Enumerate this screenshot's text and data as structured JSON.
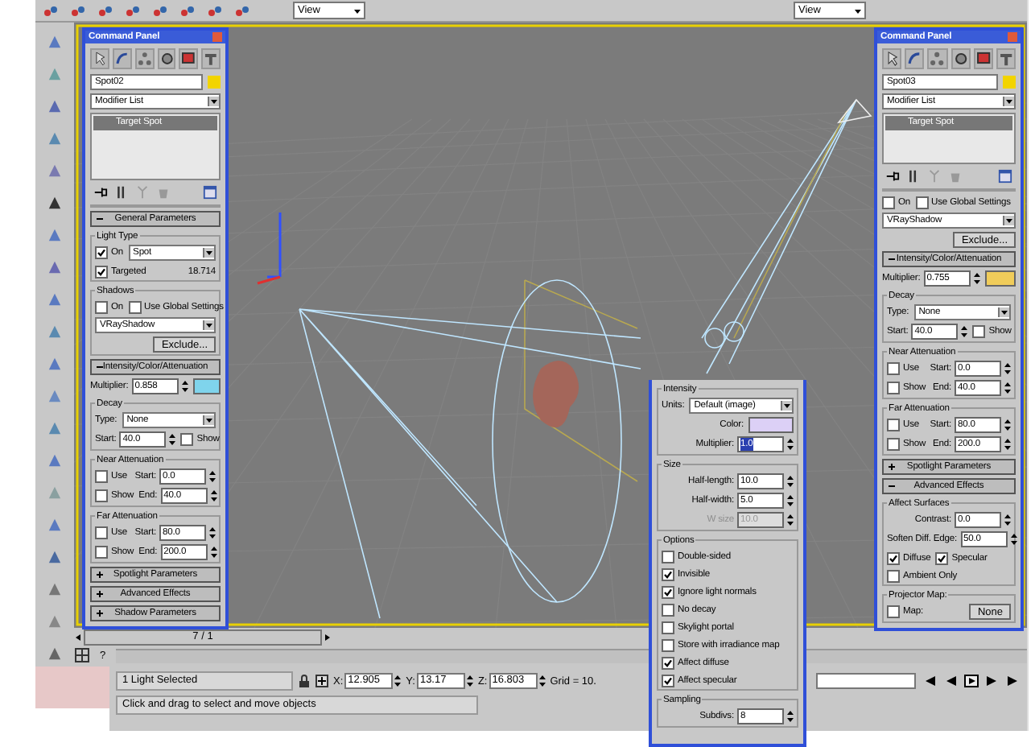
{
  "top_toolbar": {
    "dropdowns": [
      {
        "value": "View"
      },
      {
        "value": "View"
      }
    ]
  },
  "left_panel": {
    "title": "Command Panel",
    "object_name": "Spot02",
    "modifier_list": "Modifier List",
    "stack": [
      {
        "label": "Target Spot",
        "selected": true
      }
    ],
    "sections": [
      {
        "kind": "rollout",
        "title": "General Parameters",
        "expanded": true
      },
      {
        "kind": "group",
        "title": "Light Type",
        "rows": [
          {
            "items": [
              {
                "kind": "checkbox",
                "label": "On",
                "checked": true
              },
              {
                "kind": "dropdown",
                "value": "Spot"
              }
            ]
          },
          {
            "items": [
              {
                "kind": "checkbox",
                "label": "Targeted",
                "checked": true
              },
              {
                "kind": "value",
                "text": "18.714"
              }
            ]
          }
        ]
      },
      {
        "kind": "group",
        "title": "Shadows",
        "rows": [
          {
            "items": [
              {
                "kind": "checkbox",
                "label": "On",
                "checked": false
              },
              {
                "kind": "checkbox",
                "label": "Use Global Settings",
                "checked": false
              }
            ]
          },
          {
            "items": [
              {
                "kind": "dropdown",
                "value": "VRayShadow"
              }
            ]
          },
          {
            "items": [
              {
                "kind": "button",
                "label": "Exclude..."
              }
            ]
          }
        ]
      },
      {
        "kind": "rollout",
        "title": "Intensity/Color/Attenuation",
        "expanded": true
      },
      {
        "kind": "row",
        "items": [
          {
            "kind": "spinner",
            "label": "Multiplier:",
            "value": "0.858"
          },
          {
            "kind": "swatch",
            "color": "#7fd4ec"
          }
        ]
      },
      {
        "kind": "group",
        "title": "Decay",
        "rows": [
          {
            "items": [
              {
                "kind": "dropdown",
                "label": "Type:",
                "value": "None"
              }
            ]
          },
          {
            "items": [
              {
                "kind": "spinner",
                "label": "Start:",
                "value": "40.0"
              },
              {
                "kind": "checkbox",
                "label": "Show",
                "checked": false
              }
            ]
          }
        ]
      },
      {
        "kind": "group",
        "title": "Near Attenuation",
        "rows": [
          {
            "items": [
              {
                "kind": "checkbox",
                "label": "Use",
                "checked": false
              },
              {
                "kind": "spinner",
                "label": "Start:",
                "value": "0.0"
              }
            ]
          },
          {
            "items": [
              {
                "kind": "checkbox",
                "label": "Show",
                "checked": false
              },
              {
                "kind": "spinner",
                "label": "End:",
                "value": "40.0"
              }
            ]
          }
        ]
      },
      {
        "kind": "group",
        "title": "Far Attenuation",
        "rows": [
          {
            "items": [
              {
                "kind": "checkbox",
                "label": "Use",
                "checked": false
              },
              {
                "kind": "spinner",
                "label": "Start:",
                "value": "80.0"
              }
            ]
          },
          {
            "items": [
              {
                "kind": "checkbox",
                "label": "Show",
                "checked": false
              },
              {
                "kind": "spinner",
                "label": "End:",
                "value": "200.0"
              }
            ]
          }
        ]
      },
      {
        "kind": "rollout",
        "title": "Spotlight Parameters",
        "expanded": false
      },
      {
        "kind": "rollout",
        "title": "Advanced Effects",
        "expanded": false
      },
      {
        "kind": "rollout",
        "title": "Shadow Parameters",
        "expanded": false
      }
    ]
  },
  "right_panel": {
    "title": "Command Panel",
    "object_name": "Spot03",
    "modifier_list": "Modifier List",
    "stack": [
      {
        "label": "Target Spot",
        "selected": true
      }
    ],
    "sections": [
      {
        "kind": "row",
        "items": [
          {
            "kind": "checkbox",
            "label": "On",
            "checked": false
          },
          {
            "kind": "checkbox",
            "label": "Use Global Settings",
            "checked": false
          }
        ]
      },
      {
        "kind": "row",
        "items": [
          {
            "kind": "dropdown",
            "value": "VRayShadow"
          }
        ]
      },
      {
        "kind": "row",
        "items": [
          {
            "kind": "button",
            "label": "Exclude..."
          }
        ]
      },
      {
        "kind": "rollout",
        "title": "Intensity/Color/Attenuation",
        "expanded": true
      },
      {
        "kind": "row",
        "items": [
          {
            "kind": "spinner",
            "label": "Multiplier:",
            "value": "0.755"
          },
          {
            "kind": "swatch",
            "color": "#f0cc5a"
          }
        ]
      },
      {
        "kind": "group",
        "title": "Decay",
        "rows": [
          {
            "items": [
              {
                "kind": "dropdown",
                "label": "Type:",
                "value": "None"
              }
            ]
          },
          {
            "items": [
              {
                "kind": "spinner",
                "label": "Start:",
                "value": "40.0"
              },
              {
                "kind": "checkbox",
                "label": "Show",
                "checked": false
              }
            ]
          }
        ]
      },
      {
        "kind": "group",
        "title": "Near Attenuation",
        "rows": [
          {
            "items": [
              {
                "kind": "checkbox",
                "label": "Use",
                "checked": false
              },
              {
                "kind": "spinner",
                "label": "Start:",
                "value": "0.0"
              }
            ]
          },
          {
            "items": [
              {
                "kind": "checkbox",
                "label": "Show",
                "checked": false
              },
              {
                "kind": "spinner",
                "label": "End:",
                "value": "40.0"
              }
            ]
          }
        ]
      },
      {
        "kind": "group",
        "title": "Far Attenuation",
        "rows": [
          {
            "items": [
              {
                "kind": "checkbox",
                "label": "Use",
                "checked": false
              },
              {
                "kind": "spinner",
                "label": "Start:",
                "value": "80.0"
              }
            ]
          },
          {
            "items": [
              {
                "kind": "checkbox",
                "label": "Show",
                "checked": false
              },
              {
                "kind": "spinner",
                "label": "End:",
                "value": "200.0"
              }
            ]
          }
        ]
      },
      {
        "kind": "rollout",
        "title": "Spotlight Parameters",
        "expanded": false
      },
      {
        "kind": "rollout",
        "title": "Advanced Effects",
        "expanded": true
      },
      {
        "kind": "group",
        "title": "Affect Surfaces",
        "rows": [
          {
            "items": [
              {
                "kind": "spinner",
                "label": "Contrast:",
                "value": "0.0"
              }
            ]
          },
          {
            "items": [
              {
                "kind": "spinner",
                "label": "Soften Diff. Edge:",
                "value": "50.0"
              }
            ]
          },
          {
            "items": [
              {
                "kind": "checkbox",
                "label": "Diffuse",
                "checked": true
              },
              {
                "kind": "checkbox",
                "label": "Specular",
                "checked": true
              }
            ]
          },
          {
            "items": [
              {
                "kind": "checkbox",
                "label": "Ambient Only",
                "checked": false
              }
            ]
          }
        ]
      },
      {
        "kind": "group",
        "title": "Projector Map:",
        "rows": [
          {
            "items": [
              {
                "kind": "checkbox",
                "label": "Map:",
                "checked": false
              },
              {
                "kind": "button",
                "label": "None"
              }
            ]
          }
        ]
      }
    ]
  },
  "light_dialog": {
    "sections": [
      {
        "kind": "group",
        "title": "Intensity",
        "rows": [
          {
            "items": [
              {
                "kind": "dropdown",
                "label": "Units:",
                "value": "Default (image)"
              }
            ]
          },
          {
            "items": [
              {
                "kind": "swatch",
                "label": "Color:",
                "color": "#dcd0f6"
              }
            ]
          },
          {
            "items": [
              {
                "kind": "spinner",
                "label": "Multiplier:",
                "value": "1.0",
                "highlighted": true
              }
            ]
          }
        ]
      },
      {
        "kind": "group",
        "title": "Size",
        "rows": [
          {
            "items": [
              {
                "kind": "spinner",
                "label": "Half-length:",
                "value": "10.0"
              }
            ]
          },
          {
            "items": [
              {
                "kind": "spinner",
                "label": "Half-width:",
                "value": "5.0"
              }
            ]
          },
          {
            "items": [
              {
                "kind": "spinner",
                "label": "W size",
                "value": "10.0",
                "disabled": true
              }
            ]
          }
        ]
      },
      {
        "kind": "group",
        "title": "Options",
        "rows": [
          {
            "items": [
              {
                "kind": "checkbox",
                "label": "Double-sided",
                "checked": false
              }
            ]
          },
          {
            "items": [
              {
                "kind": "checkbox",
                "label": "Invisible",
                "checked": true
              }
            ]
          },
          {
            "items": [
              {
                "kind": "checkbox",
                "label": "Ignore light normals",
                "checked": true
              }
            ]
          },
          {
            "items": [
              {
                "kind": "checkbox",
                "label": "No decay",
                "checked": false
              }
            ]
          },
          {
            "items": [
              {
                "kind": "checkbox",
                "label": "Skylight portal",
                "checked": false
              }
            ]
          },
          {
            "items": [
              {
                "kind": "checkbox",
                "label": "Store with irradiance map",
                "checked": false
              }
            ]
          },
          {
            "items": [
              {
                "kind": "checkbox",
                "label": "Affect diffuse",
                "checked": true
              }
            ]
          },
          {
            "items": [
              {
                "kind": "checkbox",
                "label": "Affect specular",
                "checked": true
              }
            ]
          }
        ]
      },
      {
        "kind": "group",
        "title": "Sampling",
        "rows": [
          {
            "items": [
              {
                "kind": "spinner",
                "label": "Subdivs:",
                "value": "8"
              }
            ]
          }
        ]
      }
    ]
  },
  "time_slider": {
    "frame": "7 / 1",
    "key_hint": "?"
  },
  "status_bar": {
    "selection": "1 Light Selected",
    "prompt": "Click and drag to select and move objects",
    "coords": [
      {
        "axis": "X:",
        "value": "12.905"
      },
      {
        "axis": "Y:",
        "value": "13.17"
      },
      {
        "axis": "Z:",
        "value": "16.803"
      }
    ],
    "grid": "Grid = 10."
  }
}
